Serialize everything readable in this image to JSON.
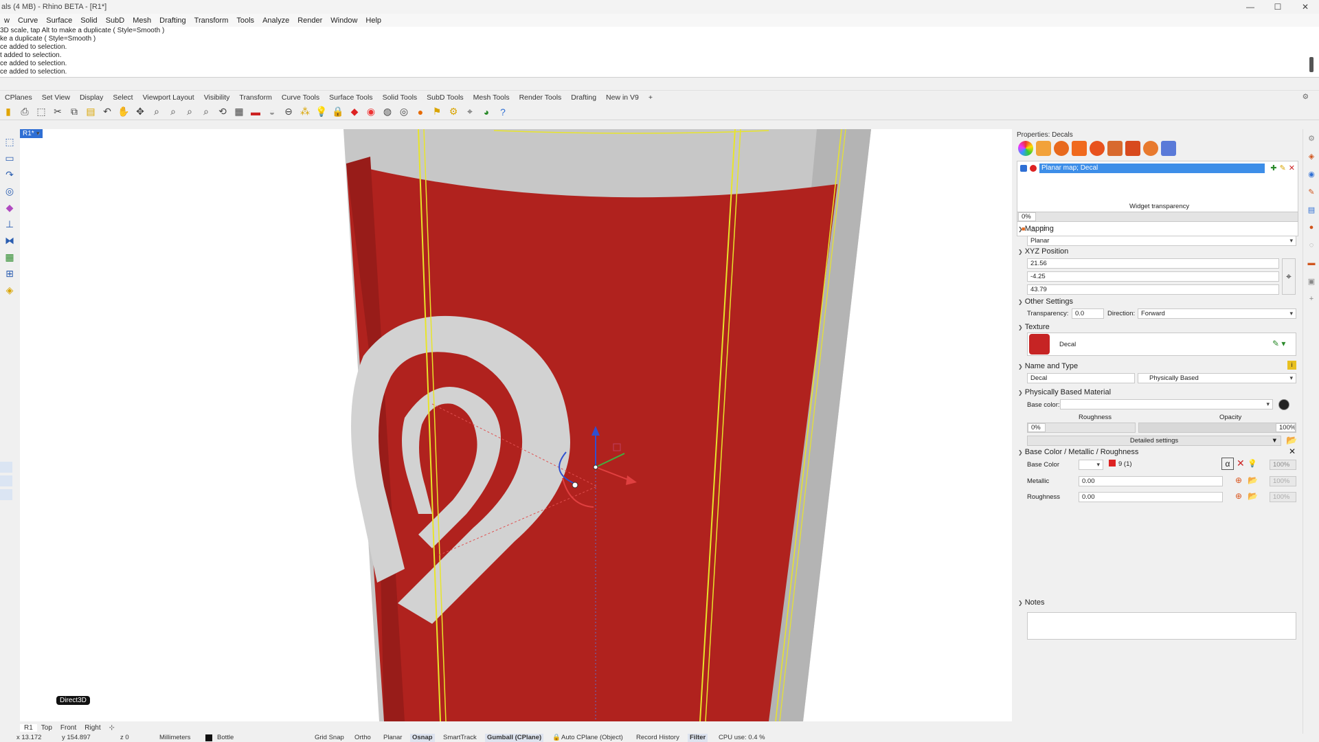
{
  "window": {
    "title": "als (4 MB) - Rhino BETA - [R1*]",
    "min_label": "—",
    "max_label": "☐",
    "close_label": "✕"
  },
  "menu": [
    "w",
    "Curve",
    "Surface",
    "Solid",
    "SubD",
    "Mesh",
    "Drafting",
    "Transform",
    "Tools",
    "Analyze",
    "Render",
    "Window",
    "Help"
  ],
  "history": [
    "3D scale, tap Alt to make a duplicate ( Style=Smooth )",
    "ke a duplicate ( Style=Smooth )",
    "ce added to selection.",
    "t added to selection.",
    "ce added to selection.",
    "ce added to selection."
  ],
  "toolbar_tabs": [
    "CPlanes",
    "Set View",
    "Display",
    "Select",
    "Viewport Layout",
    "Visibility",
    "Transform",
    "Curve Tools",
    "Surface Tools",
    "Solid Tools",
    "SubD Tools",
    "Mesh Tools",
    "Render Tools",
    "Drafting",
    "New in V9",
    "+"
  ],
  "viewport": {
    "tag": "R1*",
    "renderer": "Direct3D",
    "colors": {
      "cup_red": "#b3231f",
      "cup_gray": "#c9c9c9",
      "logo": "#d6d6d6",
      "edge_yellow": "#e8e52a"
    }
  },
  "viewport_tabs": [
    "R1",
    "Top",
    "Front",
    "Right",
    "⊹"
  ],
  "status": {
    "x": "x 13.172",
    "y": "y 154.897",
    "z": "z 0",
    "units": "Millimeters",
    "layer": "Bottle",
    "grid_snap": "Grid Snap",
    "ortho": "Ortho",
    "planar": "Planar",
    "osnap": "Osnap",
    "smarttrack": "SmartTrack",
    "gumball": "Gumball (CPlane)",
    "auto_cplane": "Auto CPlane (Object)",
    "record_history": "Record History",
    "filter": "Filter",
    "cpu": "CPU use: 0.4 %"
  },
  "panel": {
    "title": "Properties: Decals",
    "decal_item": "Planar map; Decal",
    "widget_transparency_label": "Widget transparency",
    "widget_transparency": "0%",
    "mapping_header": "Mapping",
    "mapping_value": "Planar",
    "xyz_header": "XYZ Position",
    "x": "21.56",
    "y": "-4.25",
    "z": "43.79",
    "other_header": "Other Settings",
    "transparency_label": "Transparency:",
    "transparency_value": "0.0",
    "direction_label": "Direction:",
    "direction_value": "Forward",
    "texture_header": "Texture",
    "texture_name": "Decal",
    "name_type_header": "Name and Type",
    "material_name": "Decal",
    "material_type": "Physically Based",
    "pbm_header": "Physically Based Material",
    "base_color_label": "Base color:",
    "roughness_label": "Roughness",
    "opacity_label": "Opacity",
    "roughness_value": "0%",
    "opacity_value": "100%",
    "detailed_settings": "Detailed settings",
    "bcmr_header": "Base Color /  Metallic / Roughness",
    "bc_label": "Base Color",
    "bc_slot": "9 (1)",
    "bc_amount": "100%",
    "metallic_label": "Metallic",
    "metallic_value": "0.00",
    "metallic_amount": "100%",
    "rough_label": "Roughness",
    "rough_value": "0.00",
    "rough_amount": "100%",
    "notes_header": "Notes"
  }
}
